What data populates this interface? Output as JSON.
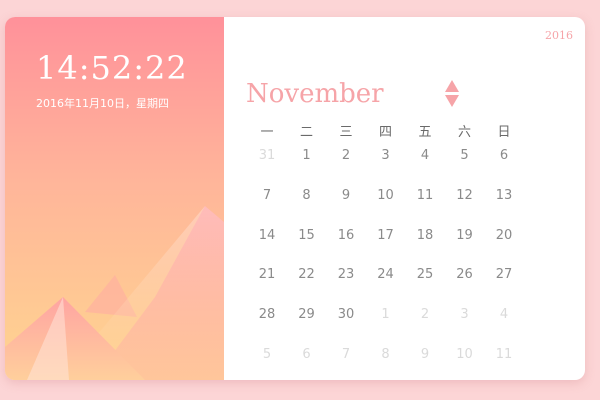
{
  "clock": {
    "time": "14:52:22",
    "date": "2016年11月10日，星期四"
  },
  "calendar": {
    "year": "2016",
    "month": "November",
    "weekdays": [
      "一",
      "二",
      "三",
      "四",
      "五",
      "六",
      "日"
    ],
    "weeks": [
      [
        {
          "d": "31",
          "other": true
        },
        {
          "d": "1"
        },
        {
          "d": "2"
        },
        {
          "d": "3"
        },
        {
          "d": "4"
        },
        {
          "d": "5"
        },
        {
          "d": "6"
        }
      ],
      [
        {
          "d": "7"
        },
        {
          "d": "8"
        },
        {
          "d": "9"
        },
        {
          "d": "10"
        },
        {
          "d": "11"
        },
        {
          "d": "12"
        },
        {
          "d": "13"
        }
      ],
      [
        {
          "d": "14"
        },
        {
          "d": "15"
        },
        {
          "d": "16"
        },
        {
          "d": "17"
        },
        {
          "d": "18"
        },
        {
          "d": "19"
        },
        {
          "d": "20"
        }
      ],
      [
        {
          "d": "21"
        },
        {
          "d": "22"
        },
        {
          "d": "23"
        },
        {
          "d": "24"
        },
        {
          "d": "25"
        },
        {
          "d": "26"
        },
        {
          "d": "27"
        }
      ],
      [
        {
          "d": "28"
        },
        {
          "d": "29"
        },
        {
          "d": "30"
        },
        {
          "d": "1",
          "other": true
        },
        {
          "d": "2",
          "other": true
        },
        {
          "d": "3",
          "other": true
        },
        {
          "d": "4",
          "other": true
        }
      ],
      [
        {
          "d": "5",
          "other": true
        },
        {
          "d": "6",
          "other": true
        },
        {
          "d": "7",
          "other": true
        },
        {
          "d": "8",
          "other": true
        },
        {
          "d": "9",
          "other": true
        },
        {
          "d": "10",
          "other": true
        },
        {
          "d": "11",
          "other": true
        }
      ]
    ]
  },
  "colors": {
    "accent": "#f6a4a8",
    "day_text": "#8a8a8a",
    "day_muted": "#dadada"
  },
  "icons": {
    "prev": "triangle-up-icon",
    "next": "triangle-down-icon"
  }
}
